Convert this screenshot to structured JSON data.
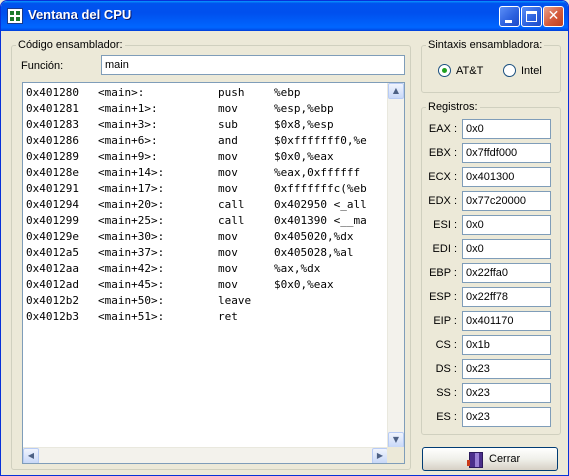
{
  "window": {
    "title": "Ventana del CPU"
  },
  "code_panel": {
    "legend": "Código ensamblador:",
    "function_label": "Función:",
    "function_value": "main",
    "lines": [
      {
        "addr": "0x401280",
        "sym": "<main>:",
        "op": "push",
        "args": "%ebp"
      },
      {
        "addr": "0x401281",
        "sym": "<main+1>:",
        "op": "mov",
        "args": "%esp,%ebp"
      },
      {
        "addr": "0x401283",
        "sym": "<main+3>:",
        "op": "sub",
        "args": "$0x8,%esp"
      },
      {
        "addr": "0x401286",
        "sym": "<main+6>:",
        "op": "and",
        "args": "$0xfffffff0,%e"
      },
      {
        "addr": "0x401289",
        "sym": "<main+9>:",
        "op": "mov",
        "args": "$0x0,%eax"
      },
      {
        "addr": "0x40128e",
        "sym": "<main+14>:",
        "op": "mov",
        "args": "%eax,0xffffff"
      },
      {
        "addr": "0x401291",
        "sym": "<main+17>:",
        "op": "mov",
        "args": "0xfffffffc(%eb"
      },
      {
        "addr": "0x401294",
        "sym": "<main+20>:",
        "op": "call",
        "args": "0x402950 <_all"
      },
      {
        "addr": "0x401299",
        "sym": "<main+25>:",
        "op": "call",
        "args": "0x401390 <__ma"
      },
      {
        "addr": "0x40129e",
        "sym": "<main+30>:",
        "op": "mov",
        "args": "0x405020,%dx"
      },
      {
        "addr": "0x4012a5",
        "sym": "<main+37>:",
        "op": "mov",
        "args": "0x405028,%al"
      },
      {
        "addr": "0x4012aa",
        "sym": "<main+42>:",
        "op": "mov",
        "args": "%ax,%dx"
      },
      {
        "addr": "0x4012ad",
        "sym": "<main+45>:",
        "op": "mov",
        "args": "$0x0,%eax"
      },
      {
        "addr": "0x4012b2",
        "sym": "<main+50>:",
        "op": "leave",
        "args": ""
      },
      {
        "addr": "0x4012b3",
        "sym": "<main+51>:",
        "op": "ret",
        "args": ""
      }
    ]
  },
  "syntax_panel": {
    "legend": "Sintaxis ensambladora:",
    "options": [
      {
        "label": "AT&T",
        "checked": true
      },
      {
        "label": "Intel",
        "checked": false
      }
    ]
  },
  "registers_panel": {
    "legend": "Registros:",
    "registers": [
      {
        "name": "EAX :",
        "value": "0x0"
      },
      {
        "name": "EBX :",
        "value": "0x7ffdf000"
      },
      {
        "name": "ECX :",
        "value": "0x401300"
      },
      {
        "name": "EDX :",
        "value": "0x77c20000"
      },
      {
        "name": "ESI :",
        "value": "0x0"
      },
      {
        "name": "EDI :",
        "value": "0x0"
      },
      {
        "name": "EBP :",
        "value": "0x22ffa0"
      },
      {
        "name": "ESP :",
        "value": "0x22ff78"
      },
      {
        "name": "EIP :",
        "value": "0x401170"
      },
      {
        "name": "CS :",
        "value": "0x1b"
      },
      {
        "name": "DS :",
        "value": "0x23"
      },
      {
        "name": "SS :",
        "value": "0x23"
      },
      {
        "name": "ES :",
        "value": "0x23"
      }
    ]
  },
  "buttons": {
    "close_label": "Cerrar"
  },
  "icons": {
    "app": "cpu-window-icon",
    "close_button": "door-exit-icon"
  },
  "colors": {
    "titlebar": "#0053ee",
    "window_bg": "#ece9d8",
    "radio_dot": "#21a121"
  }
}
